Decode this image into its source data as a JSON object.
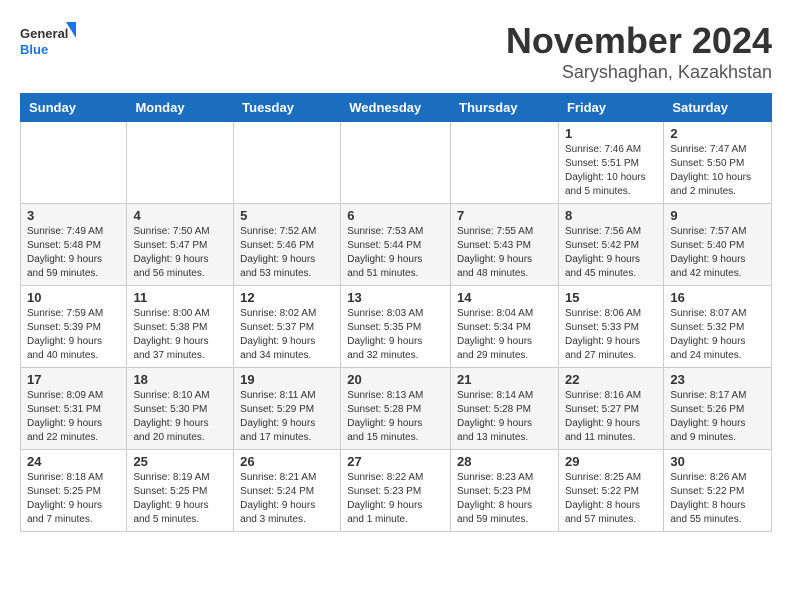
{
  "logo": {
    "line1": "General",
    "line2": "Blue"
  },
  "title": "November 2024",
  "location": "Saryshaghan, Kazakhstan",
  "weekdays": [
    "Sunday",
    "Monday",
    "Tuesday",
    "Wednesday",
    "Thursday",
    "Friday",
    "Saturday"
  ],
  "weeks": [
    [
      {
        "day": "",
        "info": ""
      },
      {
        "day": "",
        "info": ""
      },
      {
        "day": "",
        "info": ""
      },
      {
        "day": "",
        "info": ""
      },
      {
        "day": "",
        "info": ""
      },
      {
        "day": "1",
        "info": "Sunrise: 7:46 AM\nSunset: 5:51 PM\nDaylight: 10 hours\nand 5 minutes."
      },
      {
        "day": "2",
        "info": "Sunrise: 7:47 AM\nSunset: 5:50 PM\nDaylight: 10 hours\nand 2 minutes."
      }
    ],
    [
      {
        "day": "3",
        "info": "Sunrise: 7:49 AM\nSunset: 5:48 PM\nDaylight: 9 hours\nand 59 minutes."
      },
      {
        "day": "4",
        "info": "Sunrise: 7:50 AM\nSunset: 5:47 PM\nDaylight: 9 hours\nand 56 minutes."
      },
      {
        "day": "5",
        "info": "Sunrise: 7:52 AM\nSunset: 5:46 PM\nDaylight: 9 hours\nand 53 minutes."
      },
      {
        "day": "6",
        "info": "Sunrise: 7:53 AM\nSunset: 5:44 PM\nDaylight: 9 hours\nand 51 minutes."
      },
      {
        "day": "7",
        "info": "Sunrise: 7:55 AM\nSunset: 5:43 PM\nDaylight: 9 hours\nand 48 minutes."
      },
      {
        "day": "8",
        "info": "Sunrise: 7:56 AM\nSunset: 5:42 PM\nDaylight: 9 hours\nand 45 minutes."
      },
      {
        "day": "9",
        "info": "Sunrise: 7:57 AM\nSunset: 5:40 PM\nDaylight: 9 hours\nand 42 minutes."
      }
    ],
    [
      {
        "day": "10",
        "info": "Sunrise: 7:59 AM\nSunset: 5:39 PM\nDaylight: 9 hours\nand 40 minutes."
      },
      {
        "day": "11",
        "info": "Sunrise: 8:00 AM\nSunset: 5:38 PM\nDaylight: 9 hours\nand 37 minutes."
      },
      {
        "day": "12",
        "info": "Sunrise: 8:02 AM\nSunset: 5:37 PM\nDaylight: 9 hours\nand 34 minutes."
      },
      {
        "day": "13",
        "info": "Sunrise: 8:03 AM\nSunset: 5:35 PM\nDaylight: 9 hours\nand 32 minutes."
      },
      {
        "day": "14",
        "info": "Sunrise: 8:04 AM\nSunset: 5:34 PM\nDaylight: 9 hours\nand 29 minutes."
      },
      {
        "day": "15",
        "info": "Sunrise: 8:06 AM\nSunset: 5:33 PM\nDaylight: 9 hours\nand 27 minutes."
      },
      {
        "day": "16",
        "info": "Sunrise: 8:07 AM\nSunset: 5:32 PM\nDaylight: 9 hours\nand 24 minutes."
      }
    ],
    [
      {
        "day": "17",
        "info": "Sunrise: 8:09 AM\nSunset: 5:31 PM\nDaylight: 9 hours\nand 22 minutes."
      },
      {
        "day": "18",
        "info": "Sunrise: 8:10 AM\nSunset: 5:30 PM\nDaylight: 9 hours\nand 20 minutes."
      },
      {
        "day": "19",
        "info": "Sunrise: 8:11 AM\nSunset: 5:29 PM\nDaylight: 9 hours\nand 17 minutes."
      },
      {
        "day": "20",
        "info": "Sunrise: 8:13 AM\nSunset: 5:28 PM\nDaylight: 9 hours\nand 15 minutes."
      },
      {
        "day": "21",
        "info": "Sunrise: 8:14 AM\nSunset: 5:28 PM\nDaylight: 9 hours\nand 13 minutes."
      },
      {
        "day": "22",
        "info": "Sunrise: 8:16 AM\nSunset: 5:27 PM\nDaylight: 9 hours\nand 11 minutes."
      },
      {
        "day": "23",
        "info": "Sunrise: 8:17 AM\nSunset: 5:26 PM\nDaylight: 9 hours\nand 9 minutes."
      }
    ],
    [
      {
        "day": "24",
        "info": "Sunrise: 8:18 AM\nSunset: 5:25 PM\nDaylight: 9 hours\nand 7 minutes."
      },
      {
        "day": "25",
        "info": "Sunrise: 8:19 AM\nSunset: 5:25 PM\nDaylight: 9 hours\nand 5 minutes."
      },
      {
        "day": "26",
        "info": "Sunrise: 8:21 AM\nSunset: 5:24 PM\nDaylight: 9 hours\nand 3 minutes."
      },
      {
        "day": "27",
        "info": "Sunrise: 8:22 AM\nSunset: 5:23 PM\nDaylight: 9 hours\nand 1 minute."
      },
      {
        "day": "28",
        "info": "Sunrise: 8:23 AM\nSunset: 5:23 PM\nDaylight: 8 hours\nand 59 minutes."
      },
      {
        "day": "29",
        "info": "Sunrise: 8:25 AM\nSunset: 5:22 PM\nDaylight: 8 hours\nand 57 minutes."
      },
      {
        "day": "30",
        "info": "Sunrise: 8:26 AM\nSunset: 5:22 PM\nDaylight: 8 hours\nand 55 minutes."
      }
    ]
  ]
}
